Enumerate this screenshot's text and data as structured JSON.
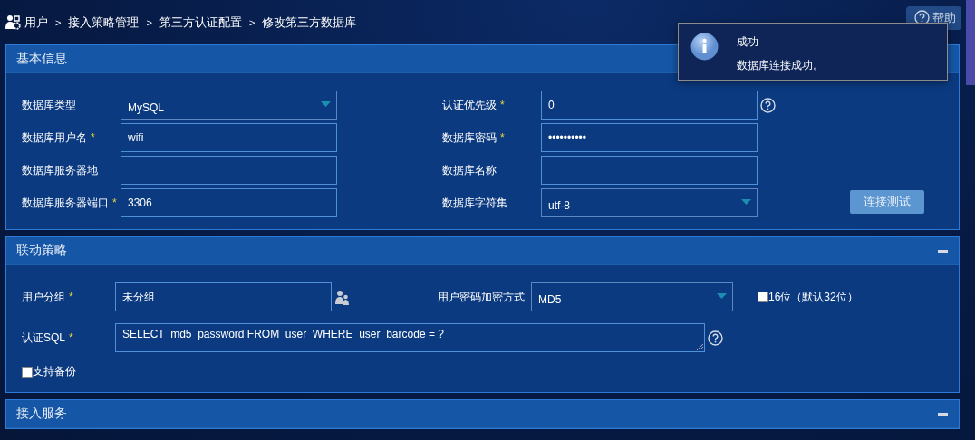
{
  "breadcrumb": {
    "separator": ">",
    "items": [
      "用户",
      "接入策略管理",
      "第三方认证配置",
      "修改第三方数据库"
    ]
  },
  "help_button": {
    "label": "帮助"
  },
  "toast": {
    "kind": "info",
    "title": "成功",
    "message": "数据库连接成功。"
  },
  "panels": [
    {
      "title": "基本信息",
      "expanded": true,
      "rows": [
        [
          {
            "label": "数据库类型",
            "kind": "select",
            "value": "MySQL"
          },
          {
            "label": "认证优先级",
            "marker": "*",
            "kind": "text",
            "value": "0",
            "help": true
          }
        ],
        [
          {
            "label": "数据库用户名",
            "marker": "*",
            "kind": "text",
            "value": "wifi"
          },
          {
            "label": "数据库密码",
            "marker": "*",
            "kind": "password",
            "value": "••••••••••"
          }
        ],
        [
          {
            "label": "数据库服务器地",
            "kind": "text"
          },
          {
            "label": "数据库名称",
            "kind": "text"
          }
        ],
        [
          {
            "label": "数据库服务器端口",
            "marker": "*",
            "kind": "text",
            "value": "3306"
          },
          {
            "label": "数据库字符集",
            "kind": "select",
            "value": "utf-8"
          }
        ]
      ],
      "action": {
        "label": "连接测试"
      }
    },
    {
      "title": "联动策略",
      "expanded": true,
      "rows": [
        [
          {
            "label": "用户分组",
            "marker": "*",
            "kind": "text",
            "value": "未分组",
            "group_picker": true
          },
          {
            "label": "用户密码加密方式",
            "kind": "select",
            "value": "MD5",
            "option": {
              "label": "16位（默认32位）",
              "checked": false
            }
          }
        ],
        [
          {
            "label": "认证SQL",
            "marker": "*",
            "kind": "textarea",
            "value": "SELECT  md5_password FROM  user  WHERE  user_barcode = ?",
            "help": true
          }
        ],
        [
          {
            "label": "支持备份",
            "kind": "checkbox",
            "checked": false
          }
        ]
      ]
    },
    {
      "title": "接入服务",
      "expanded": true
    }
  ]
}
